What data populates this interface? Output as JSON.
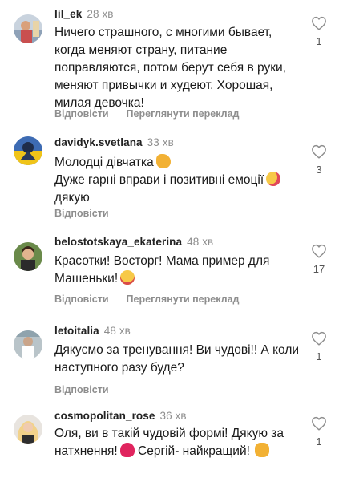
{
  "comments": [
    {
      "username": "lil_ek",
      "time": "28 хв",
      "text": "Ничего страшного, с многими бывает, когда меняют страну, питание поправляются, потом берут себя в руки, меняют привычки и худеют. Хорошая, милая девочка!",
      "reply": "Відповісти",
      "translate": "Переглянути переклад",
      "likes": "1"
    },
    {
      "username": "davidyk.svetlana",
      "time": "33 хв",
      "text_line1": "Молодці дівчатка",
      "text_line2": "Дуже гарні вправи і позитивні емоції",
      "text_line3": "дякую",
      "reply": "Відповісти",
      "likes": "3"
    },
    {
      "username": "belostotskaya_ekaterina",
      "time": "48 хв",
      "text": "Красотки! Восторг! Мама пример для Машеньки!",
      "reply": "Відповісти",
      "translate": "Переглянути переклад",
      "likes": "17"
    },
    {
      "username": "letoitalia",
      "time": "48 хв",
      "text": "Дякуємо за  тренування!  Ви чудові!! А коли наступного  разу буде?",
      "reply": "Відповісти",
      "likes": "1"
    },
    {
      "username": "cosmopolitan_rose",
      "time": "36 хв",
      "text_line1": "Оля, ви в такій чудовій формі! Дякую за",
      "text_line2": "натхнення!",
      "text_line3": " Сергій- найкращий!",
      "likes": "1"
    }
  ]
}
